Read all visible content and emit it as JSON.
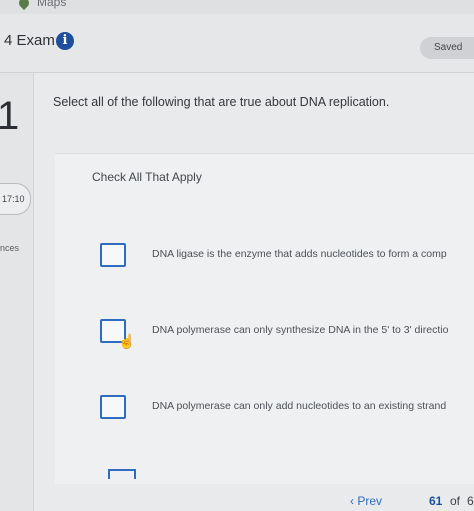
{
  "topbar": {
    "maps_label": "Maps"
  },
  "header": {
    "exam_title": "4 Exam",
    "info_icon": "i",
    "saved_label": "Saved"
  },
  "sidebar": {
    "question_number": "1",
    "timer": "17:10",
    "references_label": "nces"
  },
  "question": {
    "prompt": "Select all of the following that are true about DNA replication.",
    "instruction": "Check All That Apply",
    "options": [
      {
        "label": "DNA ligase is the enzyme that adds nucleotides to form a comp",
        "checked": false
      },
      {
        "label": "DNA polymerase can only synthesize DNA in the 5' to 3' directio",
        "checked": false
      },
      {
        "label": "DNA polymerase can only add nucleotides to an existing strand",
        "checked": false
      }
    ]
  },
  "pager": {
    "prev_label": "Prev",
    "current": "61",
    "of": "of",
    "total": "6"
  },
  "colors": {
    "accent": "#2f6bbf",
    "info": "#1f4f9c"
  }
}
